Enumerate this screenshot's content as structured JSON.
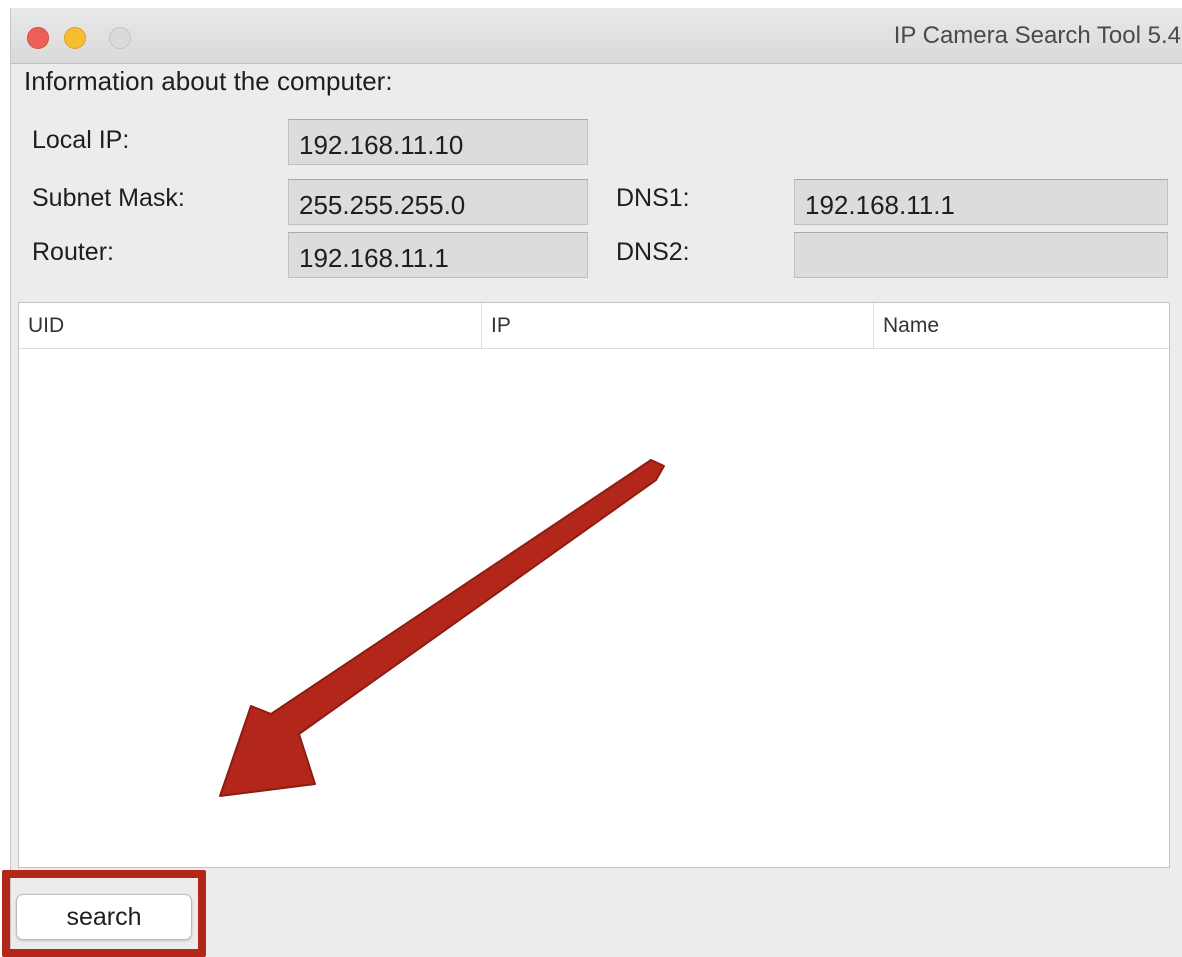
{
  "window": {
    "title": "IP Camera Search Tool 5.4"
  },
  "info": {
    "heading": "Information about the computer:",
    "local_ip_label": "Local IP:",
    "local_ip_value": "192.168.11.10",
    "subnet_label": "Subnet Mask:",
    "subnet_value": "255.255.255.0",
    "router_label": "Router:",
    "router_value": "192.168.11.1",
    "dns1_label": "DNS1:",
    "dns1_value": "192.168.11.1",
    "dns2_label": "DNS2:",
    "dns2_value": ""
  },
  "table": {
    "columns": [
      "UID",
      "IP",
      "Name"
    ],
    "rows": []
  },
  "actions": {
    "search_label": "search"
  },
  "colors": {
    "annotation": "#b3261a",
    "close": "#ee5f57",
    "minimize": "#f5bd30",
    "zoom_disabled": "#dadada"
  },
  "icons": {
    "annotation_arrow": "arrow-down-left-icon"
  }
}
